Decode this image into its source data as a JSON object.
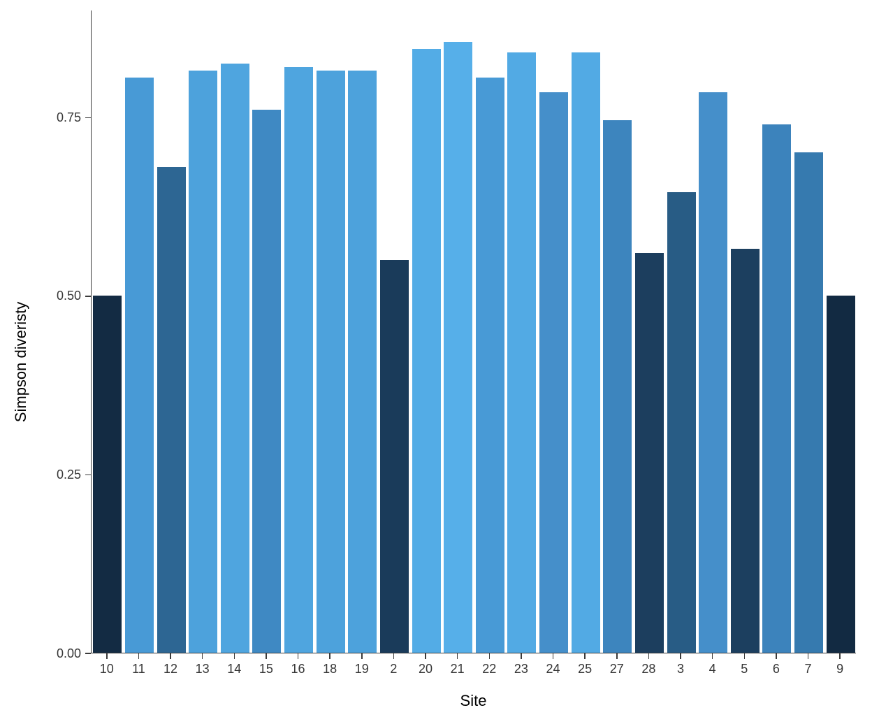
{
  "chart_data": {
    "type": "bar",
    "title": "",
    "xlabel": "Site",
    "ylabel": "Simpson diveristy",
    "ylim": [
      0,
      0.9
    ],
    "y_ticks": [
      0.0,
      0.25,
      0.5,
      0.75
    ],
    "y_tick_labels": [
      "0.00",
      "0.25",
      "0.50",
      "0.75"
    ],
    "categories": [
      "10",
      "11",
      "12",
      "13",
      "14",
      "15",
      "16",
      "18",
      "19",
      "2",
      "20",
      "21",
      "22",
      "23",
      "24",
      "25",
      "27",
      "28",
      "3",
      "4",
      "5",
      "6",
      "7",
      "9"
    ],
    "values": [
      0.5,
      0.805,
      0.68,
      0.815,
      0.825,
      0.76,
      0.82,
      0.815,
      0.815,
      0.55,
      0.845,
      0.855,
      0.805,
      0.84,
      0.785,
      0.84,
      0.745,
      0.56,
      0.645,
      0.785,
      0.565,
      0.74,
      0.7,
      0.5
    ],
    "colors": [
      "#132b43",
      "#489ad6",
      "#2d6693",
      "#4da2dc",
      "#4fa5df",
      "#3f89c3",
      "#4fa5df",
      "#4da2dc",
      "#4da2dc",
      "#1a3b5a",
      "#53ace6",
      "#56afe9",
      "#489ad6",
      "#52aae4",
      "#458fca",
      "#52aae4",
      "#3d85be",
      "#1c3e5e",
      "#285c85",
      "#458fca",
      "#1c3f5f",
      "#3c83bc",
      "#367aaf",
      "#122a42"
    ]
  }
}
